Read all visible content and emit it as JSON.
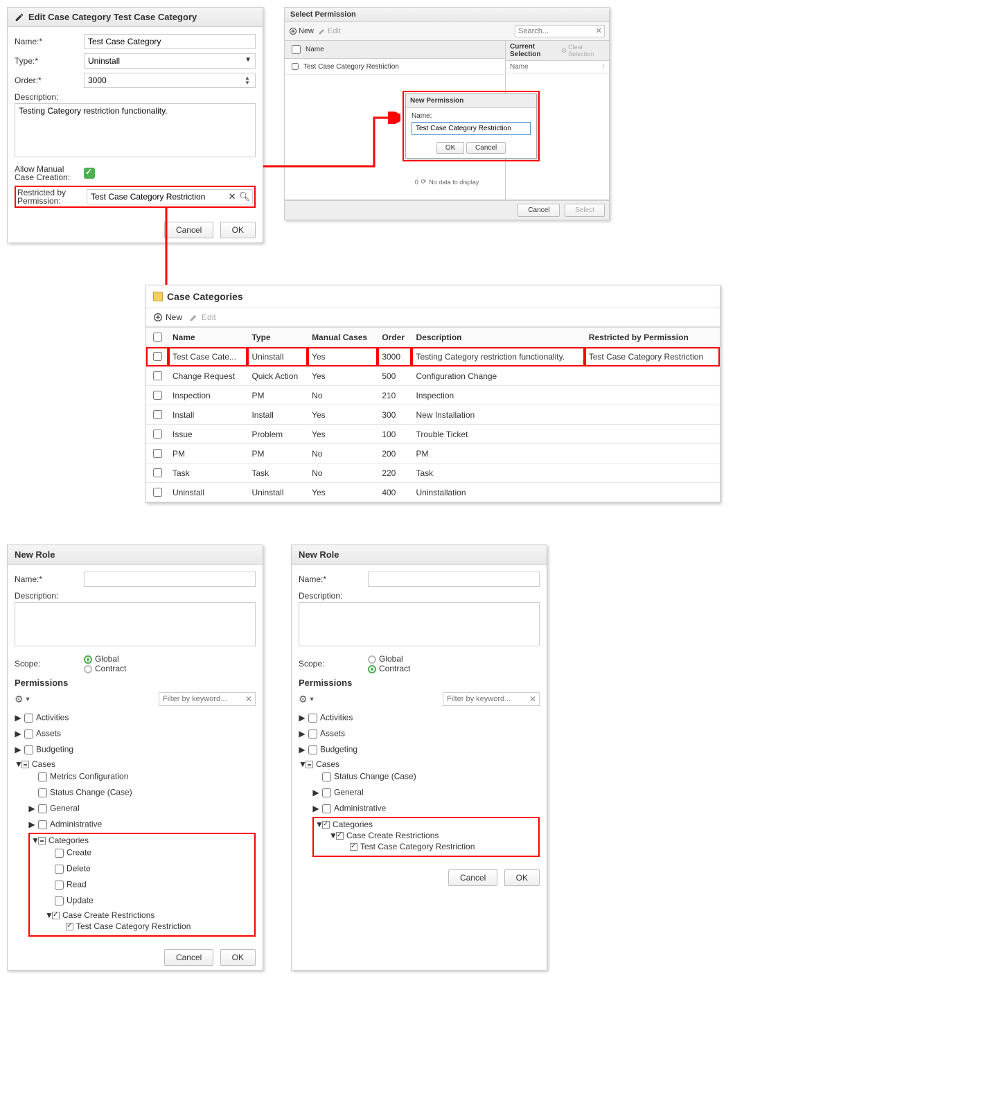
{
  "editDialog": {
    "title": "Edit Case Category Test Case Category",
    "fields": {
      "nameLabel": "Name:",
      "nameValue": "Test Case Category",
      "typeLabel": "Type:",
      "typeValue": "Uninstall",
      "orderLabel": "Order:",
      "orderValue": "3000",
      "descLabel": "Description:",
      "descValue": "Testing Category restriction functionality.",
      "allowManualLabel": "Allow Manual Case Creation:",
      "restrictedLabel": "Restricted by Permission:",
      "restrictedValue": "Test Case Category Restriction"
    },
    "buttons": {
      "cancel": "Cancel",
      "ok": "OK"
    }
  },
  "selectPermission": {
    "title": "Select Permission",
    "toolbar": {
      "new": "New",
      "edit": "Edit",
      "searchPlaceholder": "Search..."
    },
    "leftCol": {
      "header": "Name"
    },
    "leftRows": [
      "Test Case Category Restriction"
    ],
    "rightCol": {
      "header": "Current Selection",
      "clear": "Clear Selection",
      "nameHeader": "Name"
    },
    "noData": "No data to display",
    "noDataCount": "0",
    "footer": {
      "cancel": "Cancel",
      "select": "Select"
    },
    "newModal": {
      "title": "New Permission",
      "nameLabel": "Name:",
      "nameValue": "Test Case Category Restriction",
      "ok": "OK",
      "cancel": "Cancel"
    }
  },
  "caseCategories": {
    "title": "Case Categories",
    "toolbar": {
      "new": "New",
      "edit": "Edit"
    },
    "columns": [
      "Name",
      "Type",
      "Manual Cases",
      "Order",
      "Description",
      "Restricted by Permission"
    ],
    "rows": [
      {
        "name": "Test Case Cate...",
        "type": "Uninstall",
        "manual": "Yes",
        "order": "3000",
        "desc": "Testing Category restriction functionality.",
        "perm": "Test Case Category Restriction",
        "highlight": true
      },
      {
        "name": "Change Request",
        "type": "Quick Action",
        "manual": "Yes",
        "order": "500",
        "desc": "Configuration Change",
        "perm": ""
      },
      {
        "name": "Inspection",
        "type": "PM",
        "manual": "No",
        "order": "210",
        "desc": "Inspection",
        "perm": ""
      },
      {
        "name": "Install",
        "type": "Install",
        "manual": "Yes",
        "order": "300",
        "desc": "New Installation",
        "perm": ""
      },
      {
        "name": "Issue",
        "type": "Problem",
        "manual": "Yes",
        "order": "100",
        "desc": "Trouble Ticket",
        "perm": ""
      },
      {
        "name": "PM",
        "type": "PM",
        "manual": "No",
        "order": "200",
        "desc": "PM",
        "perm": ""
      },
      {
        "name": "Task",
        "type": "Task",
        "manual": "No",
        "order": "220",
        "desc": "Task",
        "perm": ""
      },
      {
        "name": "Uninstall",
        "type": "Uninstall",
        "manual": "Yes",
        "order": "400",
        "desc": "Uninstallation",
        "perm": ""
      }
    ]
  },
  "roleDialog": {
    "title": "New Role",
    "nameLabel": "Name:",
    "descLabel": "Description:",
    "scopeLabel": "Scope:",
    "scopeGlobal": "Global",
    "scopeContract": "Contract",
    "permsHeader": "Permissions",
    "filterPlaceholder": "Filter by keyword...",
    "buttons": {
      "cancel": "Cancel",
      "ok": "OK"
    }
  },
  "treeLeft": {
    "activities": "Activities",
    "assets": "Assets",
    "budgeting": "Budgeting",
    "cases": "Cases",
    "metrics": "Metrics Configuration",
    "status": "Status Change (Case)",
    "general": "General",
    "admin": "Administrative",
    "categories": "Categories",
    "create": "Create",
    "delete": "Delete",
    "read": "Read",
    "update": "Update",
    "ccr": "Case Create Restrictions",
    "tccr": "Test Case Category Restriction"
  },
  "treeRight": {
    "activities": "Activities",
    "assets": "Assets",
    "budgeting": "Budgeting",
    "cases": "Cases",
    "status": "Status Change (Case)",
    "general": "General",
    "admin": "Administrative",
    "categories": "Categories",
    "ccr": "Case Create Restrictions",
    "tccr": "Test Case Category Restriction"
  }
}
